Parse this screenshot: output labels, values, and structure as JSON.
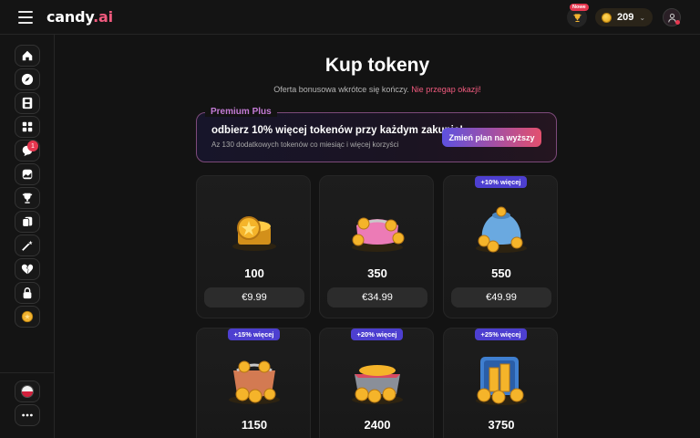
{
  "header": {
    "logo_main": "candy",
    "logo_suffix": ".ai",
    "new_badge": "Nowe",
    "token_count": "209"
  },
  "sidebar": {
    "items": [
      {
        "name": "home-icon"
      },
      {
        "name": "compass-icon"
      },
      {
        "name": "film-icon"
      },
      {
        "name": "grid-icon"
      },
      {
        "name": "chat-icon"
      },
      {
        "name": "gallery-icon"
      },
      {
        "name": "trophy-icon"
      },
      {
        "name": "cards-icon"
      },
      {
        "name": "magic-wand-icon"
      },
      {
        "name": "broken-heart-icon"
      },
      {
        "name": "lock-heart-icon"
      },
      {
        "name": "coin-icon"
      }
    ],
    "chat_badge": "1",
    "language": "pl"
  },
  "page": {
    "title": "Kup tokeny",
    "subtitle_text": "Oferta bonusowa wkrótce się kończy.",
    "subtitle_highlight": "Nie przegap okazji!"
  },
  "promo": {
    "label": "Premium Plus",
    "headline": "odbierz 10% więcej tokenów przy każdym zakupie!",
    "subtext": "Az 130 dodatkowych tokenów co miesiąc i więcej korzyści",
    "button": "Zmień plan na wyższy"
  },
  "packages": [
    {
      "amount": "100",
      "price": "€9.99",
      "bonus": "",
      "image": "coin-stack"
    },
    {
      "amount": "350",
      "price": "€34.99",
      "bonus": "",
      "image": "pink-wallet"
    },
    {
      "amount": "550",
      "price": "€49.99",
      "bonus": "+10% więcej",
      "image": "blue-pouch"
    },
    {
      "amount": "1150",
      "price": "",
      "bonus": "+15% więcej",
      "image": "leather-wallet"
    },
    {
      "amount": "2400",
      "price": "",
      "bonus": "+20% więcej",
      "image": "treasure-tray"
    },
    {
      "amount": "3750",
      "price": "",
      "bonus": "+25% więcej",
      "image": "coin-vault"
    }
  ],
  "colors": {
    "accent_pink": "#f05a7e",
    "accent_purple": "#4d3fd0",
    "coin_gold": "#f2b330",
    "background": "#131313"
  }
}
